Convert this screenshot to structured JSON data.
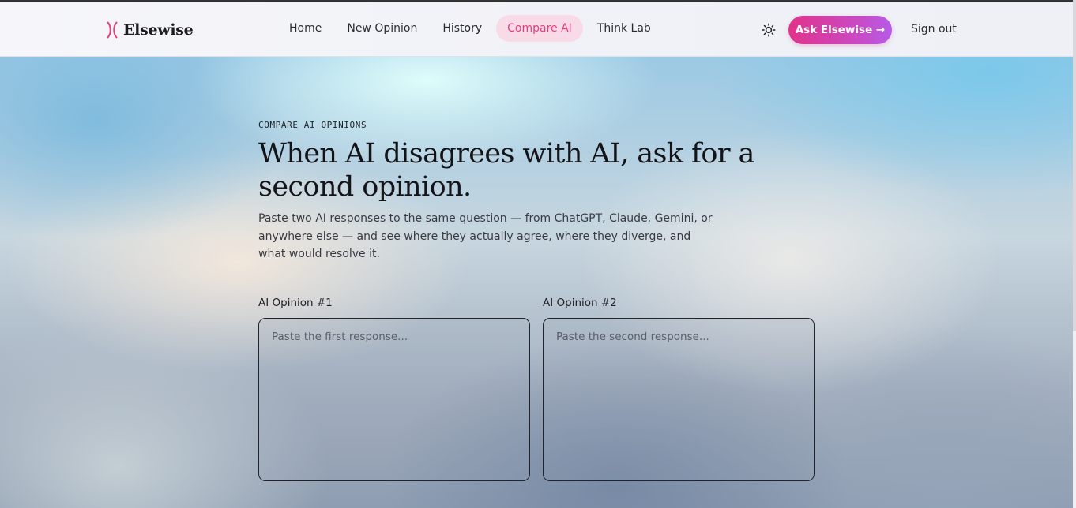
{
  "brand": {
    "name": "Elsewise"
  },
  "nav": {
    "items": [
      {
        "label": "Home",
        "active": false
      },
      {
        "label": "New Opinion",
        "active": false
      },
      {
        "label": "History",
        "active": false
      },
      {
        "label": "Compare AI",
        "active": true
      },
      {
        "label": "Think Lab",
        "active": false
      }
    ]
  },
  "header": {
    "theme_icon": "sun-icon",
    "cta_label": "Ask Elsewise →",
    "signout_label": "Sign out"
  },
  "hero": {
    "eyebrow": "COMPARE AI OPINIONS",
    "headline": "When AI disagrees with AI, ask for a second opinion.",
    "subtext": "Paste two AI responses to the same question — from ChatGPT, Claude, Gemini, or anywhere else — and see where they actually agree, where they diverge, and what would resolve it."
  },
  "form": {
    "opinion1": {
      "label": "AI Opinion #1",
      "placeholder": "Paste the first response...",
      "value": ""
    },
    "opinion2": {
      "label": "AI Opinion #2",
      "placeholder": "Paste the second response...",
      "value": ""
    }
  },
  "colors": {
    "accent": "#e2407f",
    "accent_bg": "#f9dbe8",
    "cta_gradient_start": "#e0338a",
    "cta_gradient_end": "#b45ce8"
  }
}
